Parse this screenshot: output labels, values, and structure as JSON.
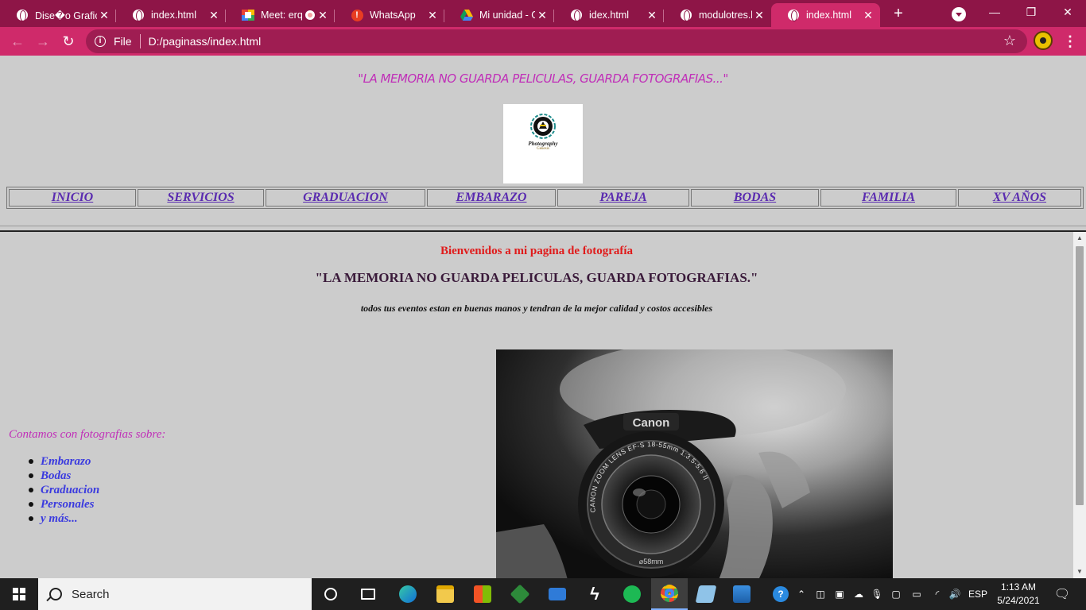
{
  "browser": {
    "tabs": [
      {
        "title": "Dise�o Grafic",
        "icon": "globe-icon",
        "active": false
      },
      {
        "title": "index.html",
        "icon": "globe-icon",
        "active": false
      },
      {
        "title": "Meet: erq",
        "icon": "meet-icon",
        "active": false
      },
      {
        "title": "WhatsApp",
        "icon": "whatsapp-icon",
        "active": false
      },
      {
        "title": "Mi unidad - G",
        "icon": "drive-icon",
        "active": false
      },
      {
        "title": "idex.html",
        "icon": "globe-icon",
        "active": false
      },
      {
        "title": "modulotres.ht",
        "icon": "globe-icon",
        "active": false
      },
      {
        "title": "index.html",
        "icon": "globe-icon",
        "active": true
      }
    ],
    "address": {
      "scheme_label": "File",
      "url": "D:/paginass/index.html"
    },
    "accent_color": "#cf2a6a"
  },
  "page": {
    "header_quote": "\"LA MEMORIA NO GUARDA PELICULAS, GUARDA FOTOGRAFIAS...\"",
    "logo": {
      "line1": "Photography",
      "line2": "Genesis"
    },
    "nav": [
      "INICIO",
      "SERVICIOS",
      "GRADUACION",
      "EMBARAZO",
      "PAREJA",
      "BODAS",
      "FAMILIA",
      "XV AÑOS"
    ],
    "welcome": "Bienvenidos a mi pagina de fotografía",
    "main_quote": "\"LA MEMORIA NO GUARDA PELICULAS, GUARDA FOTOGRAFIAS.\"",
    "tagline": "todos tus eventos estan en buenas manos y tendran de la mejor calidad y costos accesibles",
    "side_title": "Contamos con fotografias sobre:",
    "side_list": [
      "Embarazo",
      "Bodas",
      "Graduacion",
      "Personales",
      "y más..."
    ],
    "camera_text": {
      "brand": "Canon",
      "lens": "CANON ZOOM LENS EF-S 18-55mm 1:3.5-5.6 II",
      "size": "⌀58mm"
    }
  },
  "taskbar": {
    "search_placeholder": "Search",
    "language": "ESP",
    "time": "1:13 AM",
    "date": "5/24/2021"
  }
}
